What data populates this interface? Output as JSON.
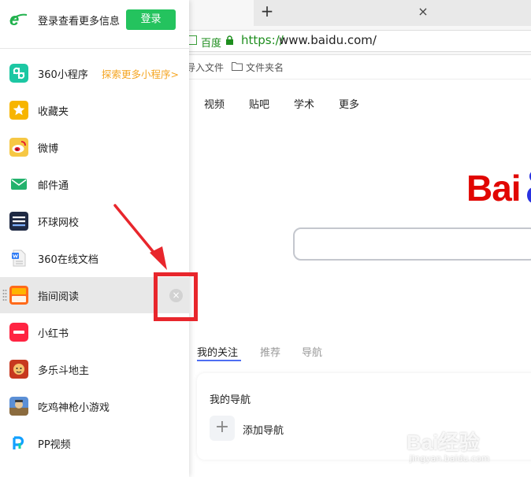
{
  "browser": {
    "address": {
      "site_name": "百度",
      "url_scheme": "https://",
      "url_rest": "www.baidu.com/"
    },
    "bookmarks": {
      "import_label": "导入文件",
      "folder_label": "文件夹名"
    },
    "top_nav": [
      "视频",
      "贴吧",
      "学术",
      "更多"
    ],
    "logo_text": "Bai",
    "feed_tabs": [
      "我的关注",
      "推荐",
      "导航"
    ],
    "nav_card": {
      "title": "我的导航",
      "add_label": "添加导航"
    },
    "watermark": {
      "text": "Bai经验",
      "url": "jingyan.baidu.com"
    }
  },
  "sidebar": {
    "login_text": "登录查看更多信息",
    "login_button": "登录",
    "items": [
      {
        "label": "360小程序",
        "extra": "探索更多小程序>",
        "icon": "mini-program-icon"
      },
      {
        "label": "收藏夹",
        "icon": "star-icon"
      },
      {
        "label": "微博",
        "icon": "weibo-icon"
      },
      {
        "label": "邮件通",
        "icon": "mail-icon"
      },
      {
        "label": "环球网校",
        "icon": "hqwx-icon"
      },
      {
        "label": "360在线文档",
        "icon": "doc-icon"
      },
      {
        "label": "指间阅读",
        "icon": "novel-icon"
      },
      {
        "label": "小红书",
        "icon": "xiaohongshu-icon"
      },
      {
        "label": "多乐斗地主",
        "icon": "doudizhu-icon"
      },
      {
        "label": "吃鸡神枪小游戏",
        "icon": "game-icon"
      },
      {
        "label": "PP视频",
        "icon": "pp-video-icon"
      }
    ]
  },
  "colors": {
    "green_accent": "#24c35e",
    "annotation_red": "#e8262c",
    "baidu_red": "#e10602",
    "baidu_blue": "#2932e1",
    "orange_link": "#f5a623"
  }
}
